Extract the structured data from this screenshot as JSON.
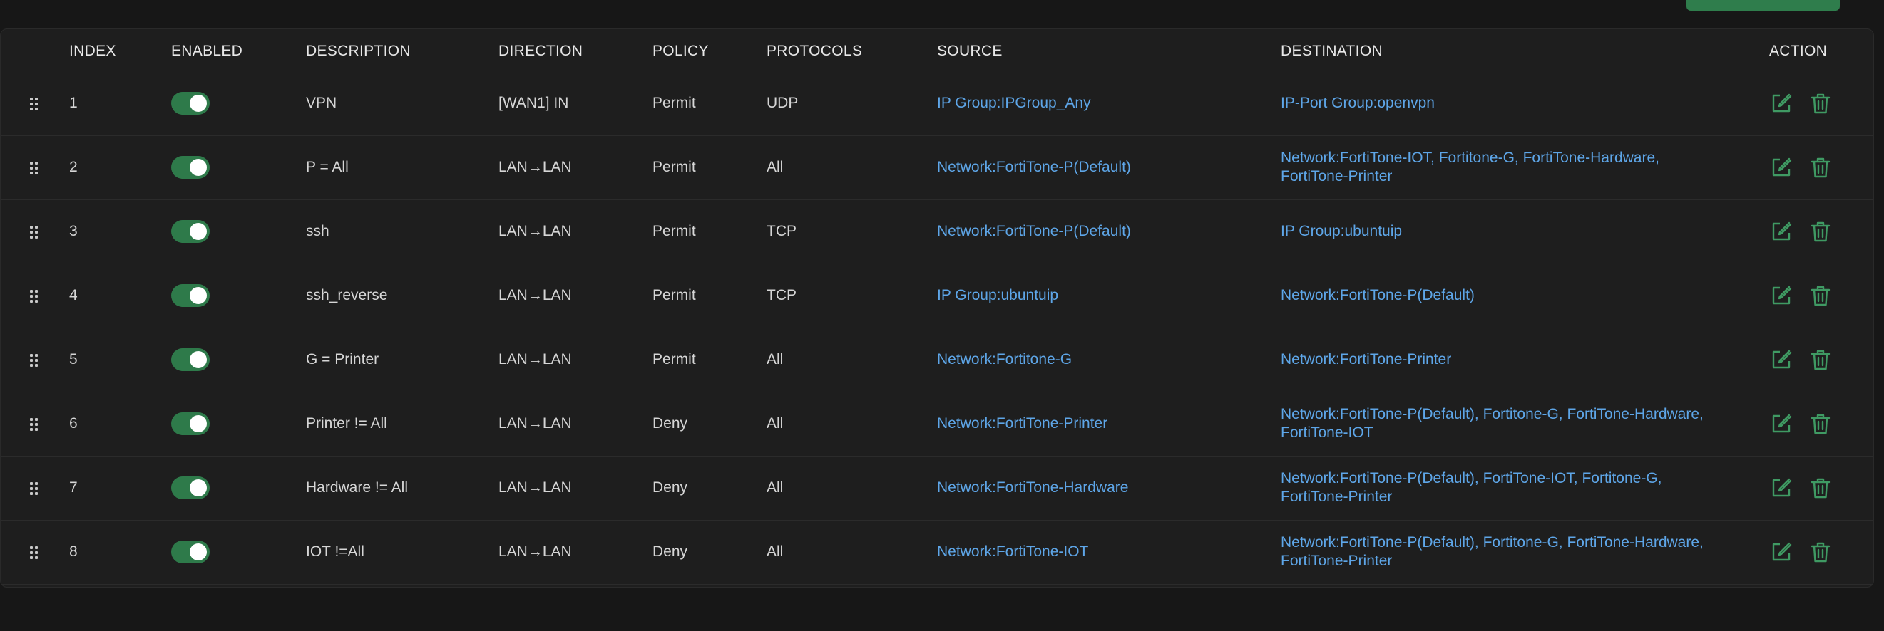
{
  "colors": {
    "accent": "#2e7a4a",
    "link": "#5ea6e8",
    "background": "#171717",
    "panel": "#1e1e1e"
  },
  "columns": {
    "index": "INDEX",
    "enabled": "ENABLED",
    "description": "DESCRIPTION",
    "direction": "DIRECTION",
    "policy": "POLICY",
    "protocols": "PROTOCOLS",
    "source": "SOURCE",
    "destination": "DESTINATION",
    "action": "ACTION"
  },
  "rows": [
    {
      "index": "1",
      "enabled": true,
      "description": "VPN",
      "direction": "[WAN1] IN",
      "policy": "Permit",
      "protocols": "UDP",
      "source": "IP Group:IPGroup_Any",
      "destination": "IP-Port Group:openvpn"
    },
    {
      "index": "2",
      "enabled": true,
      "description": "P = All",
      "direction": "LAN→LAN",
      "policy": "Permit",
      "protocols": "All",
      "source": "Network:FortiTone-P(Default)",
      "destination": "Network:FortiTone-IOT, Fortitone-G, FortiTone-Hardware, FortiTone-Printer"
    },
    {
      "index": "3",
      "enabled": true,
      "description": "ssh",
      "direction": "LAN→LAN",
      "policy": "Permit",
      "protocols": "TCP",
      "source": "Network:FortiTone-P(Default)",
      "destination": "IP Group:ubuntuip"
    },
    {
      "index": "4",
      "enabled": true,
      "description": "ssh_reverse",
      "direction": "LAN→LAN",
      "policy": "Permit",
      "protocols": "TCP",
      "source": "IP Group:ubuntuip",
      "destination": "Network:FortiTone-P(Default)"
    },
    {
      "index": "5",
      "enabled": true,
      "description": "G = Printer",
      "direction": "LAN→LAN",
      "policy": "Permit",
      "protocols": "All",
      "source": "Network:Fortitone-G",
      "destination": "Network:FortiTone-Printer"
    },
    {
      "index": "6",
      "enabled": true,
      "description": "Printer != All",
      "direction": "LAN→LAN",
      "policy": "Deny",
      "protocols": "All",
      "source": "Network:FortiTone-Printer",
      "destination": "Network:FortiTone-P(Default), Fortitone-G, FortiTone-Hardware, FortiTone-IOT"
    },
    {
      "index": "7",
      "enabled": true,
      "description": "Hardware != All",
      "direction": "LAN→LAN",
      "policy": "Deny",
      "protocols": "All",
      "source": "Network:FortiTone-Hardware",
      "destination": "Network:FortiTone-P(Default), FortiTone-IOT, Fortitone-G, FortiTone-Printer"
    },
    {
      "index": "8",
      "enabled": true,
      "description": "IOT !=All",
      "direction": "LAN→LAN",
      "policy": "Deny",
      "protocols": "All",
      "source": "Network:FortiTone-IOT",
      "destination": "Network:FortiTone-P(Default), Fortitone-G, FortiTone-Hardware, FortiTone-Printer"
    }
  ]
}
